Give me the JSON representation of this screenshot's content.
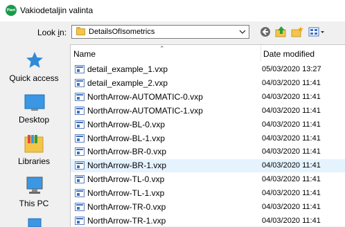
{
  "window": {
    "title": "Vakiodetaljin valinta",
    "app_icon_text": "Plant"
  },
  "lookin": {
    "label_prefix": "Look ",
    "label_underline": "i",
    "label_suffix": "n:",
    "value": "DetailsOfIsometrics"
  },
  "toolbar": {
    "back_icon": "back-arrow-icon",
    "up_icon": "up-folder-icon",
    "new_folder_icon": "new-folder-icon",
    "view_icon": "view-menu-icon"
  },
  "places": [
    {
      "label": "Quick access",
      "icon": "star-icon"
    },
    {
      "label": "Desktop",
      "icon": "desktop-icon"
    },
    {
      "label": "Libraries",
      "icon": "libraries-icon"
    },
    {
      "label": "This PC",
      "icon": "computer-icon"
    },
    {
      "label": "",
      "icon": "network-icon"
    }
  ],
  "columns": {
    "name": "Name",
    "date": "Date modified"
  },
  "files": [
    {
      "name": "detail_example_1.vxp",
      "date": "05/03/2020 13:27"
    },
    {
      "name": "detail_example_2.vxp",
      "date": "04/03/2020 11:41"
    },
    {
      "name": "NorthArrow-AUTOMATIC-0.vxp",
      "date": "04/03/2020 11:41"
    },
    {
      "name": "NorthArrow-AUTOMATIC-1.vxp",
      "date": "04/03/2020 11:41"
    },
    {
      "name": "NorthArrow-BL-0.vxp",
      "date": "04/03/2020 11:41"
    },
    {
      "name": "NorthArrow-BL-1.vxp",
      "date": "04/03/2020 11:41"
    },
    {
      "name": "NorthArrow-BR-0.vxp",
      "date": "04/03/2020 11:41"
    },
    {
      "name": "NorthArrow-BR-1.vxp",
      "date": "04/03/2020 11:41",
      "selected": true
    },
    {
      "name": "NorthArrow-TL-0.vxp",
      "date": "04/03/2020 11:41"
    },
    {
      "name": "NorthArrow-TL-1.vxp",
      "date": "04/03/2020 11:41"
    },
    {
      "name": "NorthArrow-TR-0.vxp",
      "date": "04/03/2020 11:41"
    },
    {
      "name": "NorthArrow-TR-1.vxp",
      "date": "04/03/2020 11:41"
    }
  ],
  "colors": {
    "selection": "#e5f3ff",
    "accent": "#1a9a4a",
    "folder": "#f3c64a"
  }
}
